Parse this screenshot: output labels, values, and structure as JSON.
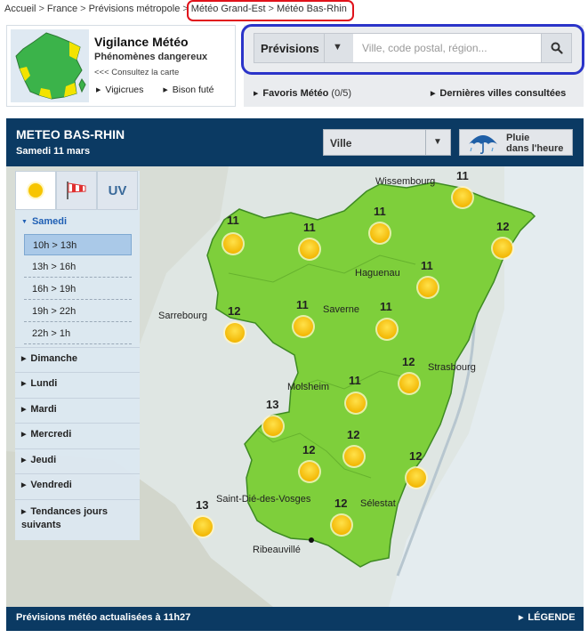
{
  "breadcrumb": {
    "items": [
      "Accueil",
      "France",
      "Prévisions métropole",
      "Météo Grand-Est",
      "Météo Bas-Rhin"
    ],
    "separator": ">"
  },
  "vigilance": {
    "title": "Vigilance Météo",
    "subtitle": "Phénomènes dangereux",
    "map_link": "<<< Consultez la carte",
    "links": [
      "Vigicrues",
      "Bison futé"
    ]
  },
  "search": {
    "select_label": "Prévisions",
    "placeholder": "Ville, code postal, région...",
    "favorites_label": "Favoris Météo",
    "favorites_count": "(0/5)",
    "last_cities_label": "Dernières villes consultées"
  },
  "panel": {
    "title": "METEO BAS-RHIN",
    "date": "Samedi 11 mars",
    "ville_select": "Ville",
    "rain_button": [
      "Pluie",
      "dans l'heure"
    ],
    "footer_text": "Prévisions météo actualisées à 11h27",
    "legend_label": "LÉGENDE"
  },
  "sidemenu": {
    "tabs": [
      {
        "icon": "sun-icon"
      },
      {
        "icon": "windsock-icon"
      },
      {
        "label": "UV"
      }
    ],
    "open_day": "Samedi",
    "slots": [
      "10h > 13h",
      "13h > 16h",
      "16h > 19h",
      "19h > 22h",
      "22h > 1h"
    ],
    "selected_slot": 0,
    "days": [
      "Dimanche",
      "Lundi",
      "Mardi",
      "Mercredi",
      "Jeudi",
      "Vendredi",
      "Tendances jours suivants"
    ]
  },
  "map": {
    "cities": [
      "Wissembourg",
      "Haguenau",
      "Sarrebourg",
      "Saverne",
      "Strasbourg",
      "Molsheim",
      "Saint-Dié-des-Vosges",
      "Sélestat",
      "Ribeauvillé"
    ],
    "temperatures": [
      "11",
      "11",
      "11",
      "12",
      "11",
      "11",
      "12",
      "11",
      "11",
      "12",
      "11",
      "13",
      "12",
      "12",
      "12",
      "13",
      "12"
    ]
  },
  "colors": {
    "header_blue": "#0b3a63",
    "map_green": "#7ecf3b",
    "sun_yellow": "#f7c500",
    "breadcrumb_highlight": "#e0121b",
    "search_highlight": "#2b34c9"
  }
}
